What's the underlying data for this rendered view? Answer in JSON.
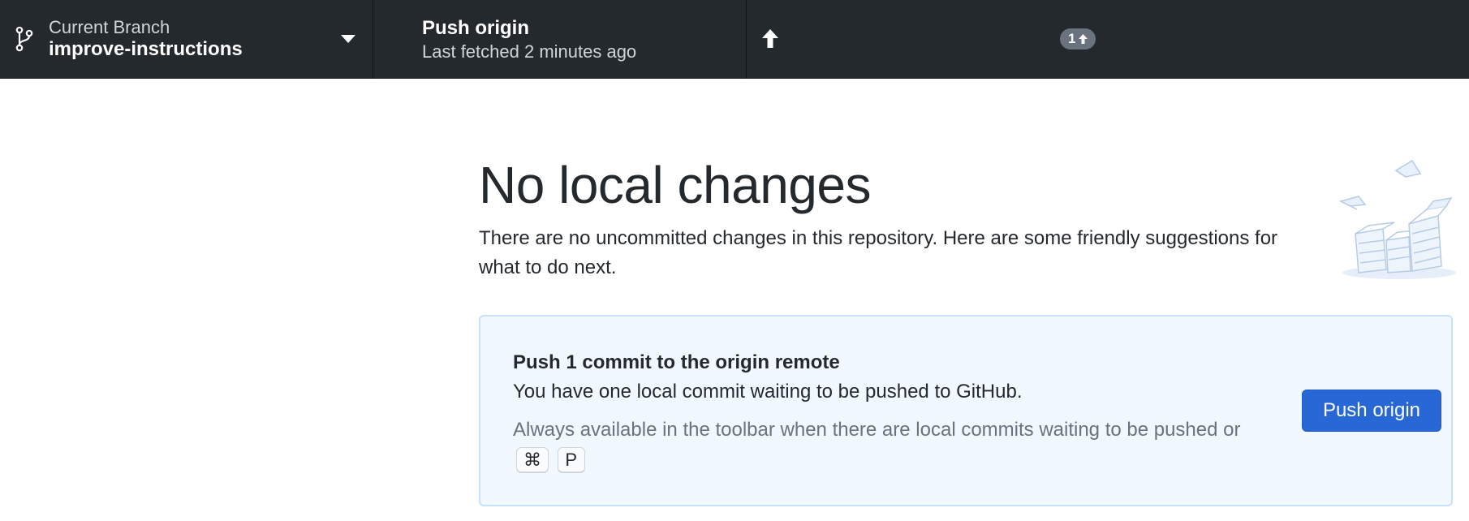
{
  "toolbar": {
    "branch": {
      "label": "Current Branch",
      "name": "improve-instructions",
      "icon": "git-branch-icon",
      "caret_icon": "triangle-down-icon"
    },
    "push": {
      "title": "Push origin",
      "subtitle": "Last fetched 2 minutes ago",
      "icon": "arrow-up-icon",
      "ahead_count": "1"
    }
  },
  "main": {
    "heading": "No local changes",
    "intro": "There are no uncommitted changes in this repository. Here are some friendly suggestions for what to do next.",
    "illustration": "empty-boxes-illustration",
    "suggestion": {
      "title": "Push 1 commit to the origin remote",
      "description": "You have one local commit waiting to be pushed to GitHub.",
      "hint": "Always available in the toolbar when there are local commits waiting to be pushed or",
      "shortcut_keys": [
        "⌘",
        "P"
      ],
      "button_label": "Push origin"
    }
  },
  "colors": {
    "toolbar_bg": "#24292e",
    "card_bg": "#f1f8ff",
    "card_border": "#c8e1ff",
    "primary_button": "#2767d6",
    "muted_text": "#6a737d"
  }
}
